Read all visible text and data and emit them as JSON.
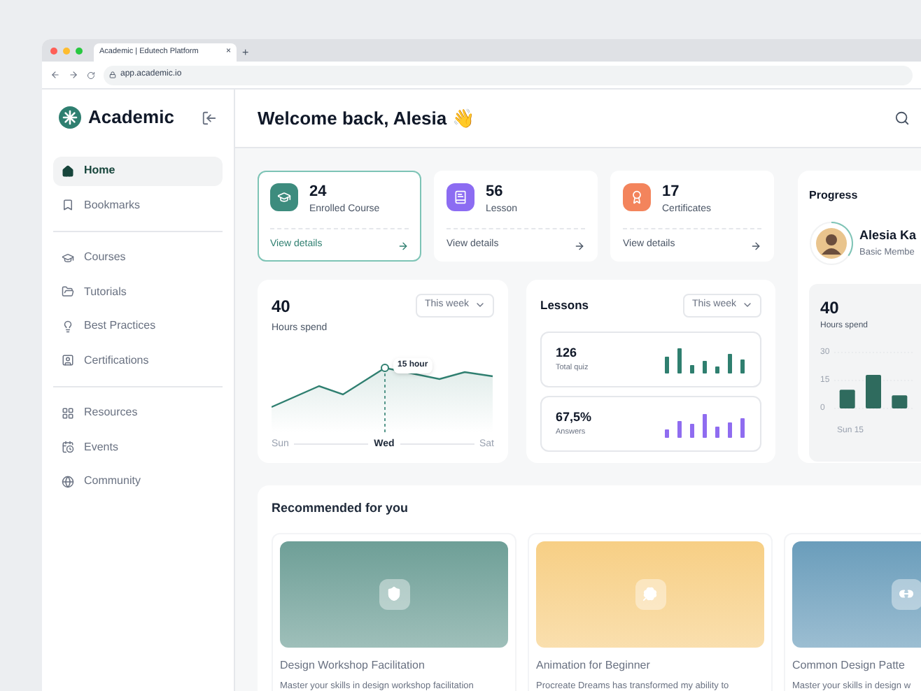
{
  "browser": {
    "tab_title": "Academic | Edutech Platform",
    "tab_close": "×",
    "new_tab": "+",
    "url": "app.academic.io"
  },
  "sidebar": {
    "brand": "Academic",
    "sections": [
      {
        "items": [
          {
            "label": "Home",
            "selected": true
          },
          {
            "label": "Bookmarks",
            "selected": false
          }
        ]
      },
      {
        "items": [
          {
            "label": "Courses",
            "selected": false
          },
          {
            "label": "Tutorials",
            "selected": false
          },
          {
            "label": "Best Practices",
            "selected": false
          },
          {
            "label": "Certifications",
            "selected": false
          }
        ]
      },
      {
        "items": [
          {
            "label": "Resources",
            "selected": false
          },
          {
            "label": "Events",
            "selected": false
          },
          {
            "label": "Community",
            "selected": false
          }
        ]
      }
    ]
  },
  "header": {
    "title": "Welcome back, Alesia",
    "emoji": "👋"
  },
  "stats": [
    {
      "value": "24",
      "label": "Enrolled Course",
      "link": "View details",
      "selected": true,
      "color": "#3d8c7e"
    },
    {
      "value": "56",
      "label": "Lesson",
      "link": "View details",
      "selected": false,
      "color": "#8c6cf2"
    },
    {
      "value": "17",
      "label": "Certificates",
      "link": "View details",
      "selected": false,
      "color": "#f3845c"
    }
  ],
  "hours": {
    "value": "40",
    "label": "Hours spend",
    "period": "This week",
    "tooltip": "15 hour",
    "x_labels": [
      {
        "label": "Sun",
        "selected": false
      },
      {
        "label": "Wed",
        "selected": true
      },
      {
        "label": "Sat",
        "selected": false
      }
    ]
  },
  "lessons": {
    "title": "Lessons",
    "period": "This week",
    "metrics": [
      {
        "value": "126",
        "label": "Total quiz",
        "color": "#2f7f6f"
      },
      {
        "value": "67,5%",
        "label": "Answers",
        "color": "#8f6cf0"
      }
    ]
  },
  "progress": {
    "title": "Progress",
    "name": "Alesia Ka",
    "membership": "Basic Membe",
    "hours_value": "40",
    "hours_label": "Hours spend",
    "first_label": "Sun 15",
    "chart_data": {
      "type": "bar",
      "categories": [
        null,
        null,
        null
      ],
      "values": [
        10,
        18,
        7
      ],
      "ylim": [
        0,
        30
      ],
      "yticks": [
        0,
        15,
        30
      ]
    }
  },
  "recommended": {
    "title": "Recommended for you",
    "courses": [
      {
        "title": "Design Workshop Facilitation",
        "description": "Master your skills in design workshop facilitation",
        "color": "#6e9f97"
      },
      {
        "title": "Animation for Beginner",
        "description": "Procreate Dreams has transformed my ability to",
        "color": "#f7cf85"
      },
      {
        "title": "Common Design Patte",
        "description": "Master your skills in design w",
        "color": "#6a9dbb"
      }
    ]
  }
}
